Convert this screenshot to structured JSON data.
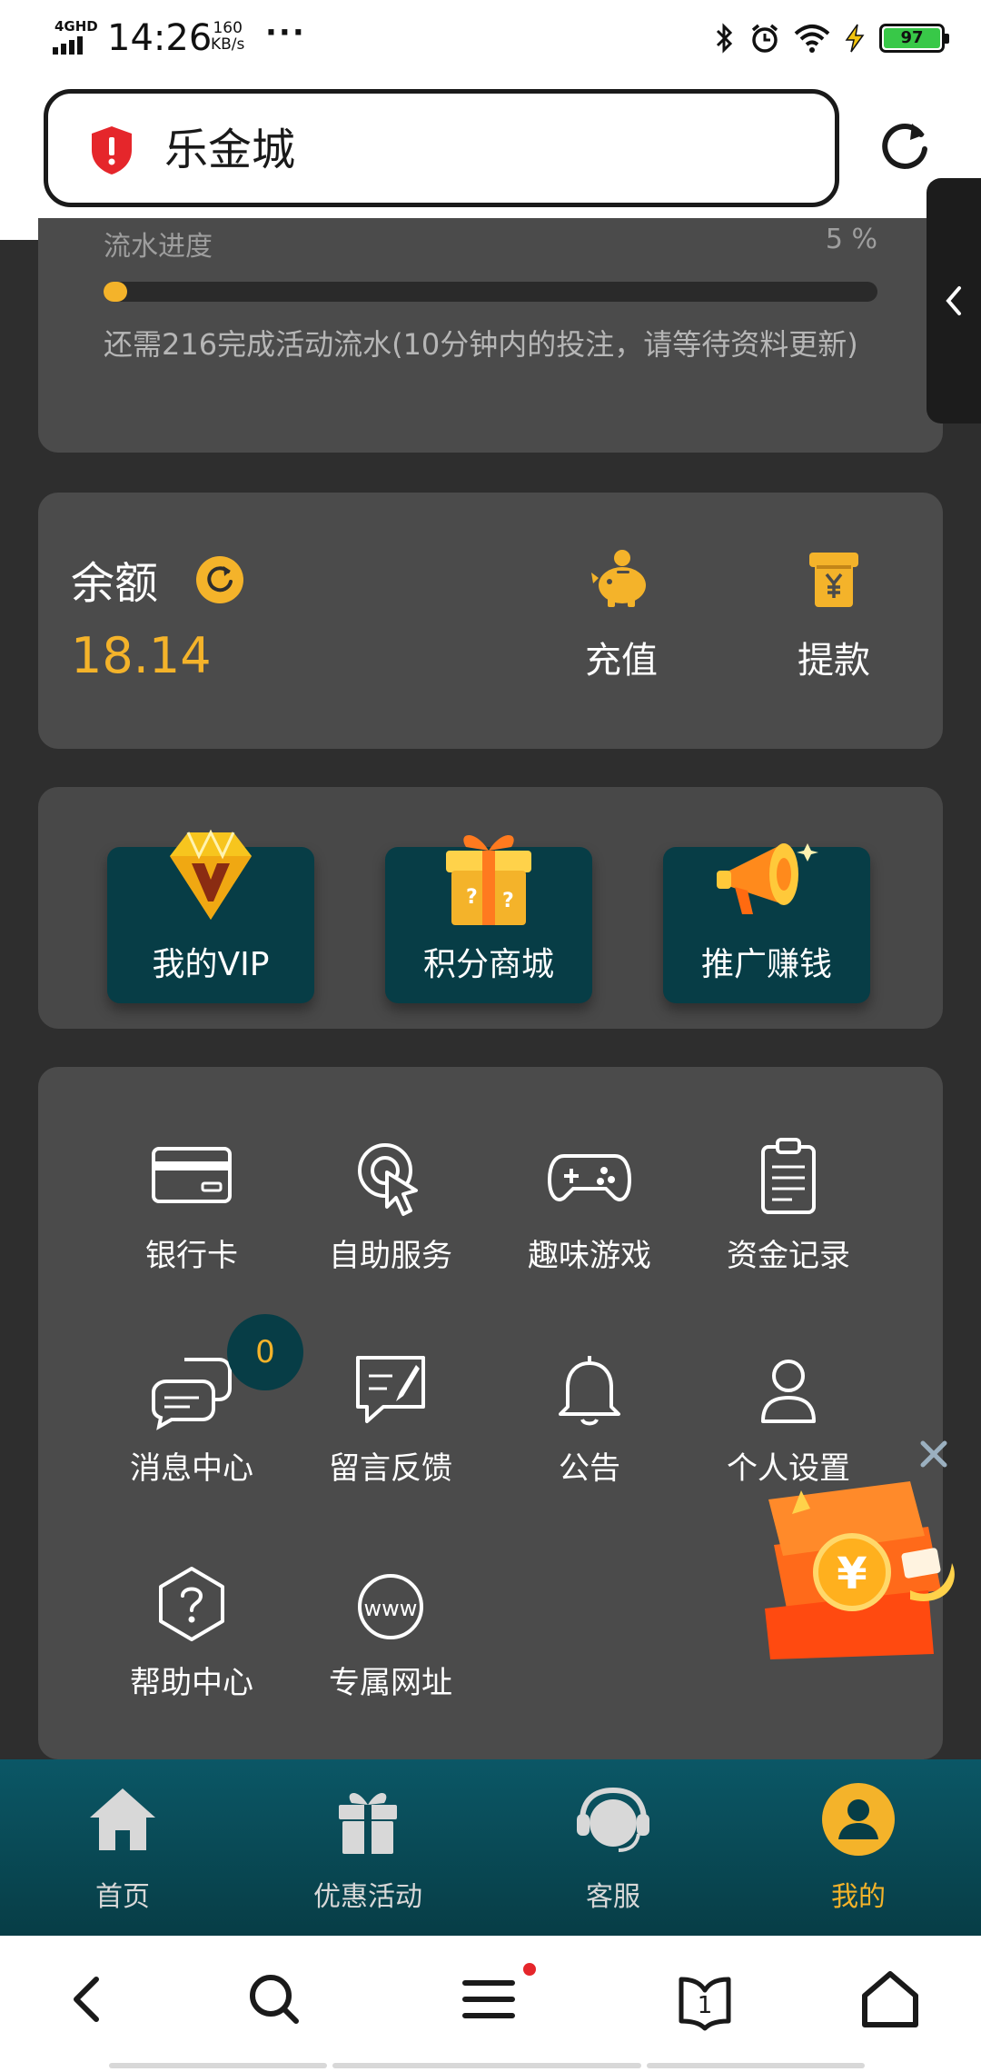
{
  "status_bar": {
    "network": "4GHD",
    "time": "14:26",
    "speed_value": "160",
    "speed_unit": "KB/s",
    "more": "···",
    "battery": "97",
    "icons": [
      "bluetooth-icon",
      "alarm-icon",
      "wifi-icon",
      "charging-icon",
      "battery-icon"
    ]
  },
  "browser": {
    "url_title": "乐金城",
    "security_icon": "shield-alert-icon",
    "reload_icon": "reload-icon",
    "side_handle_icon": "chevron-left-icon"
  },
  "progress_card": {
    "label": "流水进度",
    "percent_text": "5 %",
    "percent": 0.02,
    "note": "还需216完成活动流水(10分钟内的投注，请等待资料更新)"
  },
  "balance_card": {
    "label": "余额",
    "value": "18.14",
    "deposit_label": "充值",
    "withdraw_label": "提款"
  },
  "features": [
    {
      "label": "我的VIP",
      "icon": "vip-diamond-icon"
    },
    {
      "label": "积分商城",
      "icon": "gift-box-icon"
    },
    {
      "label": "推广赚钱",
      "icon": "megaphone-icon"
    }
  ],
  "menu": [
    {
      "label": "银行卡",
      "icon": "bank-card-icon"
    },
    {
      "label": "自助服务",
      "icon": "self-service-icon"
    },
    {
      "label": "趣味游戏",
      "icon": "gamepad-icon"
    },
    {
      "label": "资金记录",
      "icon": "clipboard-icon"
    },
    {
      "label": "消息中心",
      "icon": "chat-icon"
    },
    {
      "label": "留言反馈",
      "icon": "feedback-icon"
    },
    {
      "label": "公告",
      "icon": "bell-icon"
    },
    {
      "label": "个人设置",
      "icon": "user-icon"
    },
    {
      "label": "帮助中心",
      "icon": "help-icon"
    },
    {
      "label": "专属网址",
      "icon": "www-icon"
    }
  ],
  "message_badge": "0",
  "tabbar": [
    {
      "label": "首页",
      "icon": "home-icon"
    },
    {
      "label": "优惠活动",
      "icon": "gift-icon"
    },
    {
      "label": "客服",
      "icon": "headset-icon"
    },
    {
      "label": "我的",
      "icon": "user-circle-icon"
    }
  ],
  "browser_nav": {
    "tabs_count": "1",
    "icons": [
      "back-icon",
      "search-icon",
      "menu-icon",
      "tabs-icon",
      "home-icon"
    ]
  },
  "colors": {
    "accent": "#f4b32a",
    "card": "#4b4b4b",
    "background": "#2e2e2e",
    "tabbar": "#073d46"
  }
}
